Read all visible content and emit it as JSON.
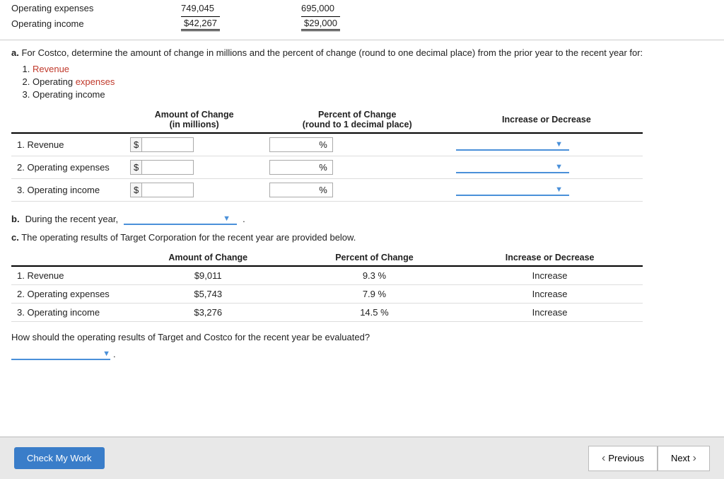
{
  "top_financials": {
    "row1": {
      "label": "Operating expenses",
      "val1": "749,045",
      "val2": "695,000"
    },
    "row2": {
      "label": "Operating income",
      "val1": "$42,267",
      "val2": "$29,000"
    }
  },
  "question_a": {
    "text": "For Costco, determine the amount of change in millions and the percent of change (round to one decimal place) from the prior year to the recent year for:",
    "items": [
      {
        "num": "1.",
        "text": "Revenue",
        "link": true
      },
      {
        "num": "2.",
        "text": "Operating ",
        "link_text": "expenses",
        "link": true
      },
      {
        "num": "3.",
        "text": "Operating income",
        "link": false
      }
    ],
    "table": {
      "col1": "Amount of Change",
      "col1b": "(in millions)",
      "col2": "Percent of Change",
      "col2b": "(round to 1 decimal place)",
      "col3": "Increase or Decrease",
      "rows": [
        {
          "label": "1. Revenue",
          "dollar_val": "",
          "percent_val": "",
          "dropdown_val": ""
        },
        {
          "label": "2. Operating expenses",
          "dollar_val": "",
          "percent_val": "",
          "dropdown_val": ""
        },
        {
          "label": "3. Operating income",
          "dollar_val": "",
          "percent_val": "",
          "dropdown_val": ""
        }
      ]
    }
  },
  "question_b": {
    "prefix": "b.",
    "text": "During the recent year,",
    "dropdown_val": ""
  },
  "question_c": {
    "prefix": "c.",
    "text": "The operating results of Target Corporation for the recent year are provided below.",
    "table": {
      "col1": "Amount of Change",
      "col2": "Percent of Change",
      "col3": "Increase or Decrease",
      "rows": [
        {
          "label": "1. Revenue",
          "amount": "$9,011",
          "percent": "9.3 %",
          "direction": "Increase"
        },
        {
          "label": "2. Operating expenses",
          "amount": "$5,743",
          "percent": "7.9 %",
          "direction": "Increase"
        },
        {
          "label": "3. Operating income",
          "amount": "$3,276",
          "percent": "14.5 %",
          "direction": "Increase"
        }
      ]
    }
  },
  "how_evaluate": {
    "text": "How should the operating results of Target and Costco for the recent year be evaluated?",
    "dropdown_val": ""
  },
  "footer": {
    "check_work": "Check My Work",
    "previous": "Previous",
    "next": "Next"
  }
}
